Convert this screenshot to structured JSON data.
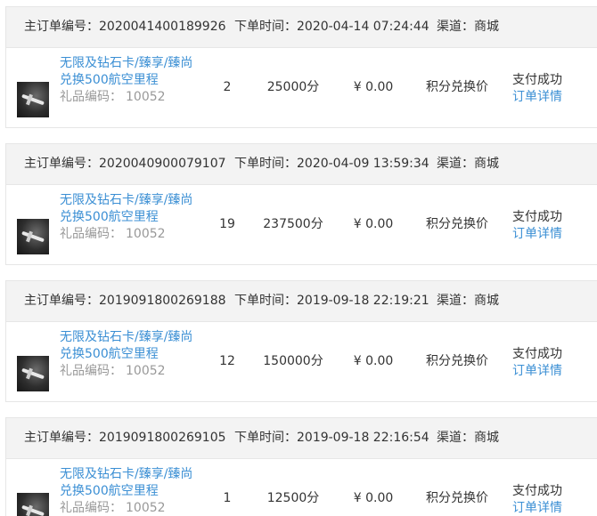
{
  "labels": {
    "order_id": "主订单编号：",
    "order_time": "下单时间：",
    "channel": "渠道：",
    "product_code": "礼品编码："
  },
  "orders": [
    {
      "order_id": "2020041400189926",
      "order_time": "2020-04-14 07:24:44",
      "channel": "商城",
      "product_title": "无限及钻石卡/臻享/臻尚兑换500航空里程",
      "product_code": "10052",
      "quantity": "2",
      "points": "25000分",
      "price": "¥ 0.00",
      "pay_type": "积分兑换价",
      "status": "支付成功",
      "detail_link": "订单详情"
    },
    {
      "order_id": "2020040900079107",
      "order_time": "2020-04-09 13:59:34",
      "channel": "商城",
      "product_title": "无限及钻石卡/臻享/臻尚兑换500航空里程",
      "product_code": "10052",
      "quantity": "19",
      "points": "237500分",
      "price": "¥ 0.00",
      "pay_type": "积分兑换价",
      "status": "支付成功",
      "detail_link": "订单详情"
    },
    {
      "order_id": "2019091800269188",
      "order_time": "2019-09-18 22:19:21",
      "channel": "商城",
      "product_title": "无限及钻石卡/臻享/臻尚兑换500航空里程",
      "product_code": "10052",
      "quantity": "12",
      "points": "150000分",
      "price": "¥ 0.00",
      "pay_type": "积分兑换价",
      "status": "支付成功",
      "detail_link": "订单详情"
    },
    {
      "order_id": "2019091800269105",
      "order_time": "2019-09-18 22:16:54",
      "channel": "商城",
      "product_title": "无限及钻石卡/臻享/臻尚兑换500航空里程",
      "product_code": "10052",
      "quantity": "1",
      "points": "12500分",
      "price": "¥ 0.00",
      "pay_type": "积分兑换价",
      "status": "支付成功",
      "detail_link": "订单详情"
    }
  ]
}
